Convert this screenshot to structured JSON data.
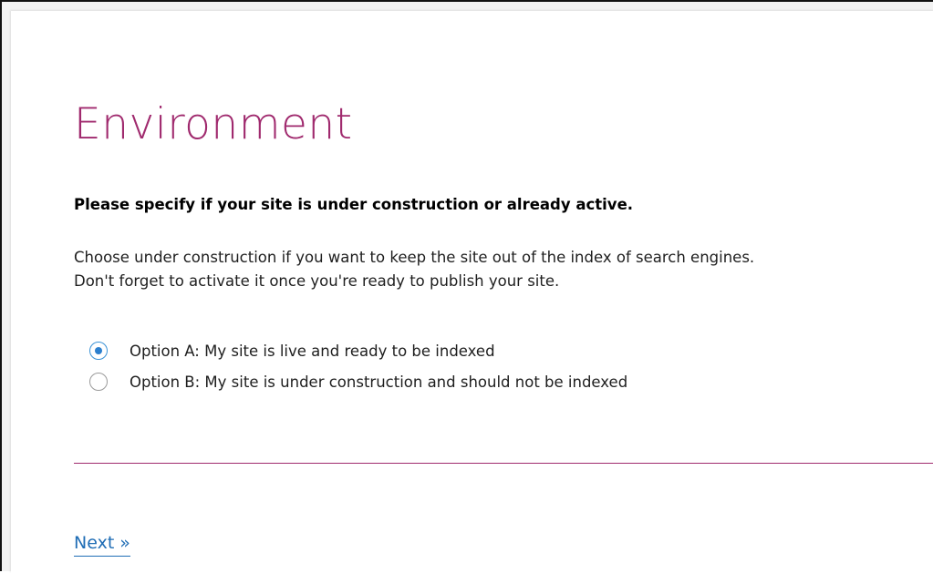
{
  "page": {
    "title": "Environment",
    "question": "Please specify if your site is under construction or already active.",
    "description_lines": [
      "Choose under construction if you want to keep the site out of the index of search engines.",
      "Don't forget to activate it once you're ready to publish your site."
    ]
  },
  "options": [
    {
      "label": "Option A: My site is live and ready to be indexed",
      "selected": true
    },
    {
      "label": "Option B: My site is under construction and should not be indexed",
      "selected": false
    }
  ],
  "footer": {
    "next_label": "Next »"
  },
  "colors": {
    "accent": "#a02a6e",
    "link": "#1f6db5",
    "radio_selected": "#2b7fce"
  }
}
